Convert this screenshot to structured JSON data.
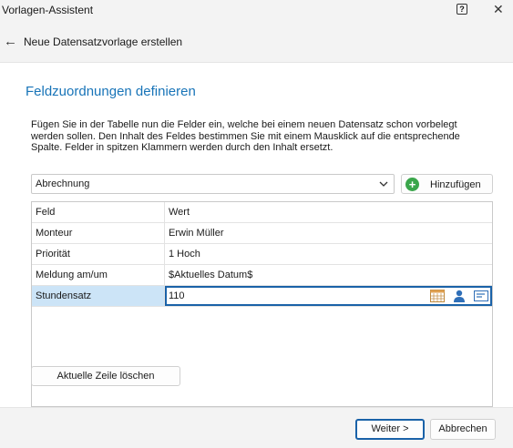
{
  "window": {
    "title": "Vorlagen-Assistent"
  },
  "nav": {
    "title": "Neue Datensatzvorlage erstellen"
  },
  "page": {
    "heading": "Feldzuordnungen definieren",
    "description": "Fügen Sie in der Tabelle nun die Felder ein, welche bei einem neuen Datensatz schon vorbelegt werden sollen. Den Inhalt des Feldes bestimmen Sie mit einem Mausklick auf die entsprechende Spalte. Felder in spitzen Klammern werden durch den Inhalt ersetzt."
  },
  "field_select": {
    "value": "Abrechnung"
  },
  "add_button": {
    "label": "Hinzufügen"
  },
  "table": {
    "headers": [
      "Feld",
      "Wert"
    ],
    "rows": [
      {
        "field": "Monteur",
        "value": "Erwin Müller"
      },
      {
        "field": "Priorität",
        "value": "1 Hoch"
      },
      {
        "field": "Meldung am/um",
        "value": "$Aktuelles Datum$"
      },
      {
        "field": "Stundensatz",
        "value": "110"
      }
    ],
    "selected_row": 3
  },
  "delete_row_button": {
    "label": "Aktuelle Zeile löschen"
  },
  "footer": {
    "next_label": "Weiter >",
    "cancel_label": "Abbrechen"
  },
  "colors": {
    "accent": "#1874b8",
    "selection": "#cce4f7",
    "focus_border": "#1a62a8",
    "add_green": "#3aa64b"
  }
}
